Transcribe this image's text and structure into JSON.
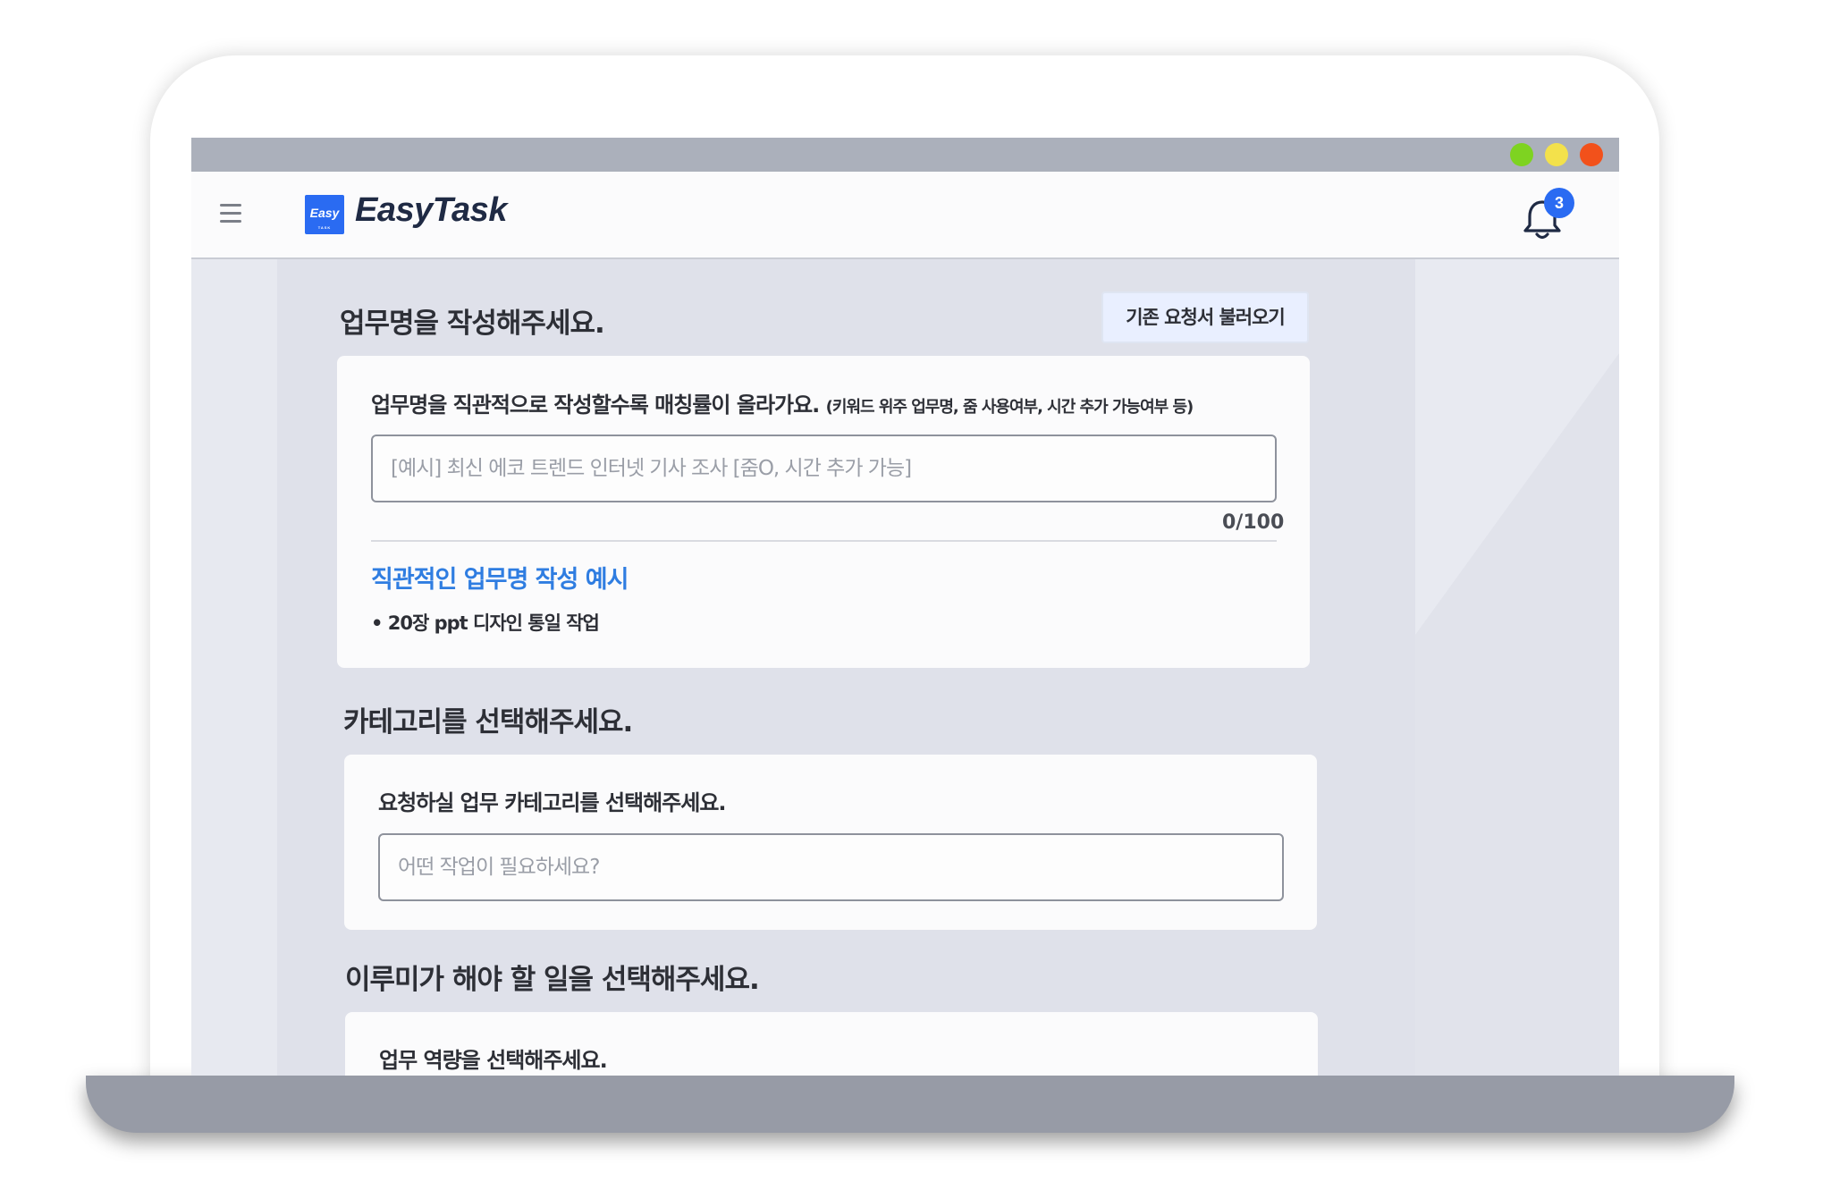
{
  "app": {
    "name": "EasyTask",
    "logo_badge": "Easy",
    "logo_badge_sub": "TASK",
    "notification_count": "3"
  },
  "task_name": {
    "section_title": "업무명을 작성해주세요.",
    "load_button": "기존 요청서 불러오기",
    "label": "업무명을 직관적으로 작성할수록 매칭률이 올라가요.",
    "hint": "(키워드 위주 업무명, 줌 사용여부, 시간 추가 가능여부 등)",
    "placeholder": "[예시] 최신 에코 트렌드 인터넷 기사 조사 [줌O, 시간 추가 가능]",
    "counter": "0/100",
    "example_title": "직관적인 업무명 작성 예시",
    "example_item": "• 20장 ppt 디자인 통일 작업"
  },
  "category": {
    "section_title": "카테고리를 선택해주세요.",
    "label": "요청하실 업무 카테고리를 선택해주세요.",
    "placeholder": "어떤 작업이 필요하세요?"
  },
  "tasks": {
    "section_title": "이루미가 해야 할 일을 선택해주세요.",
    "label": "업무 역량을 선택해주세요."
  },
  "colors": {
    "accent": "#2a6bf2",
    "link": "#2f7de1",
    "window_green": "#7ed321",
    "window_yellow": "#f3e14b",
    "window_red": "#f2511b"
  },
  "icons": {
    "menu": "hamburger-icon",
    "notification": "bell-icon"
  }
}
